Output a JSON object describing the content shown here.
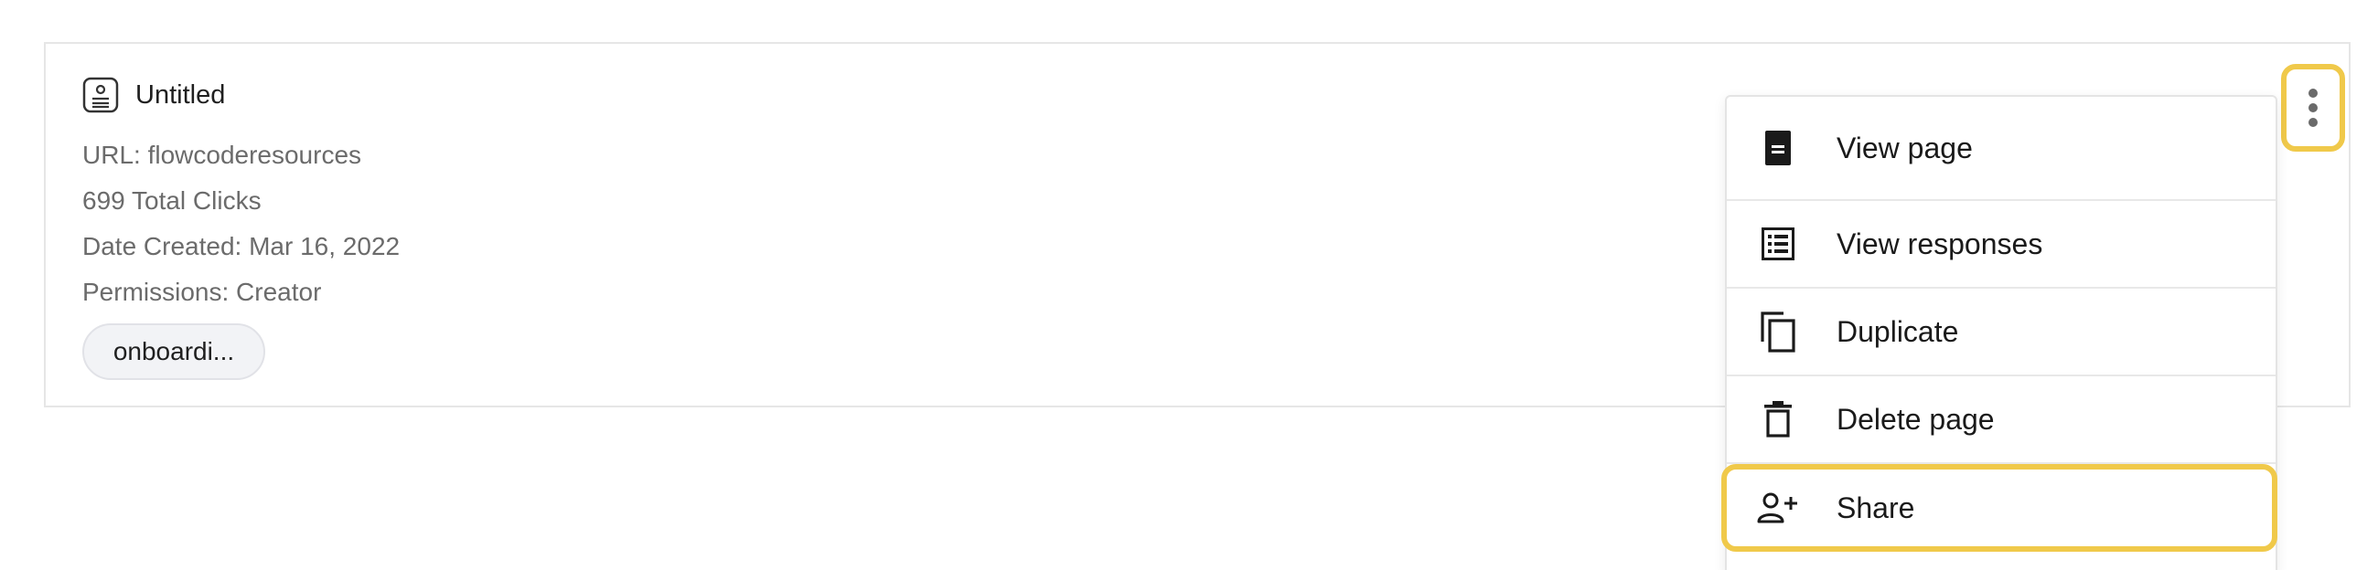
{
  "card": {
    "title": "Untitled",
    "url": "URL: flowcoderesources",
    "clicks": "699 Total Clicks",
    "date_created": "Date Created: Mar 16, 2022",
    "permissions": "Permissions: Creator",
    "tag": "onboardi..."
  },
  "menu": {
    "items": [
      {
        "label": "View page",
        "icon": "document-icon"
      },
      {
        "label": "View responses",
        "icon": "list-icon"
      },
      {
        "label": "Duplicate",
        "icon": "copy-icon"
      },
      {
        "label": "Delete page",
        "icon": "trash-icon"
      },
      {
        "label": "Share",
        "icon": "user-plus-icon"
      }
    ]
  },
  "colors": {
    "highlight": "#f0c94a",
    "text_primary": "#1a1a1a",
    "text_secondary": "#6b6b6b",
    "border": "#e6e6e6"
  }
}
